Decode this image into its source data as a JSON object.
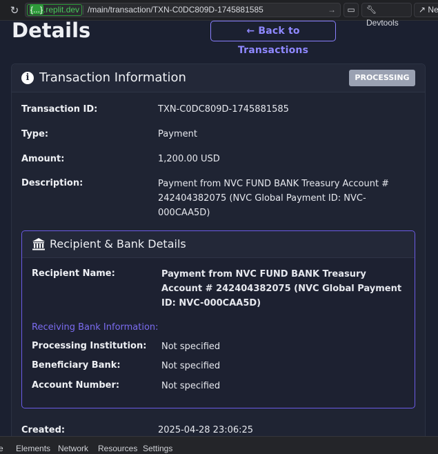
{
  "browser": {
    "host_prefix": "{...}",
    "host": ".replit.dev",
    "path": "/main/transaction/TXN-C0DC809D-1745881585",
    "devtools_label": "Devtools",
    "new_tab_label": "Ne"
  },
  "page": {
    "title": "Details",
    "back_button": "Back to Transactions"
  },
  "card": {
    "title": "Transaction Information",
    "status": "PROCESSING",
    "fields": {
      "txn_label": "Transaction ID:",
      "txn_value": "TXN-C0DC809D-1745881585",
      "type_label": "Type:",
      "type_value": "Payment",
      "amount_label": "Amount:",
      "amount_value": "1,200.00 USD",
      "desc_label": "Description:",
      "desc_value": "Payment from NVC FUND BANK Treasury Account # 242404382075 (NVC Global Payment ID: NVC-000CAA5D)",
      "created_label": "Created:",
      "created_value": "2025-04-28 23:06:25"
    }
  },
  "recipient": {
    "title": "Recipient & Bank Details",
    "name_label": "Recipient Name:",
    "name_value": "Payment from NVC FUND BANK Treasury Account # 242404382075 (NVC Global Payment ID: NVC-000CAA5D)",
    "section_title": "Receiving Bank Information:",
    "institution_label": "Processing Institution:",
    "institution_value": "Not specified",
    "beneficiary_label": "Beneficiary Bank:",
    "beneficiary_value": "Not specified",
    "account_label": "Account Number:",
    "account_value": "Not specified"
  },
  "devtools": {
    "tabs": [
      "e",
      "Elements",
      "Network",
      "Resources",
      "Settings"
    ]
  },
  "colors": {
    "accent": "#8a80ff",
    "badge": "#9aa1b2",
    "background": "#1b2030"
  }
}
